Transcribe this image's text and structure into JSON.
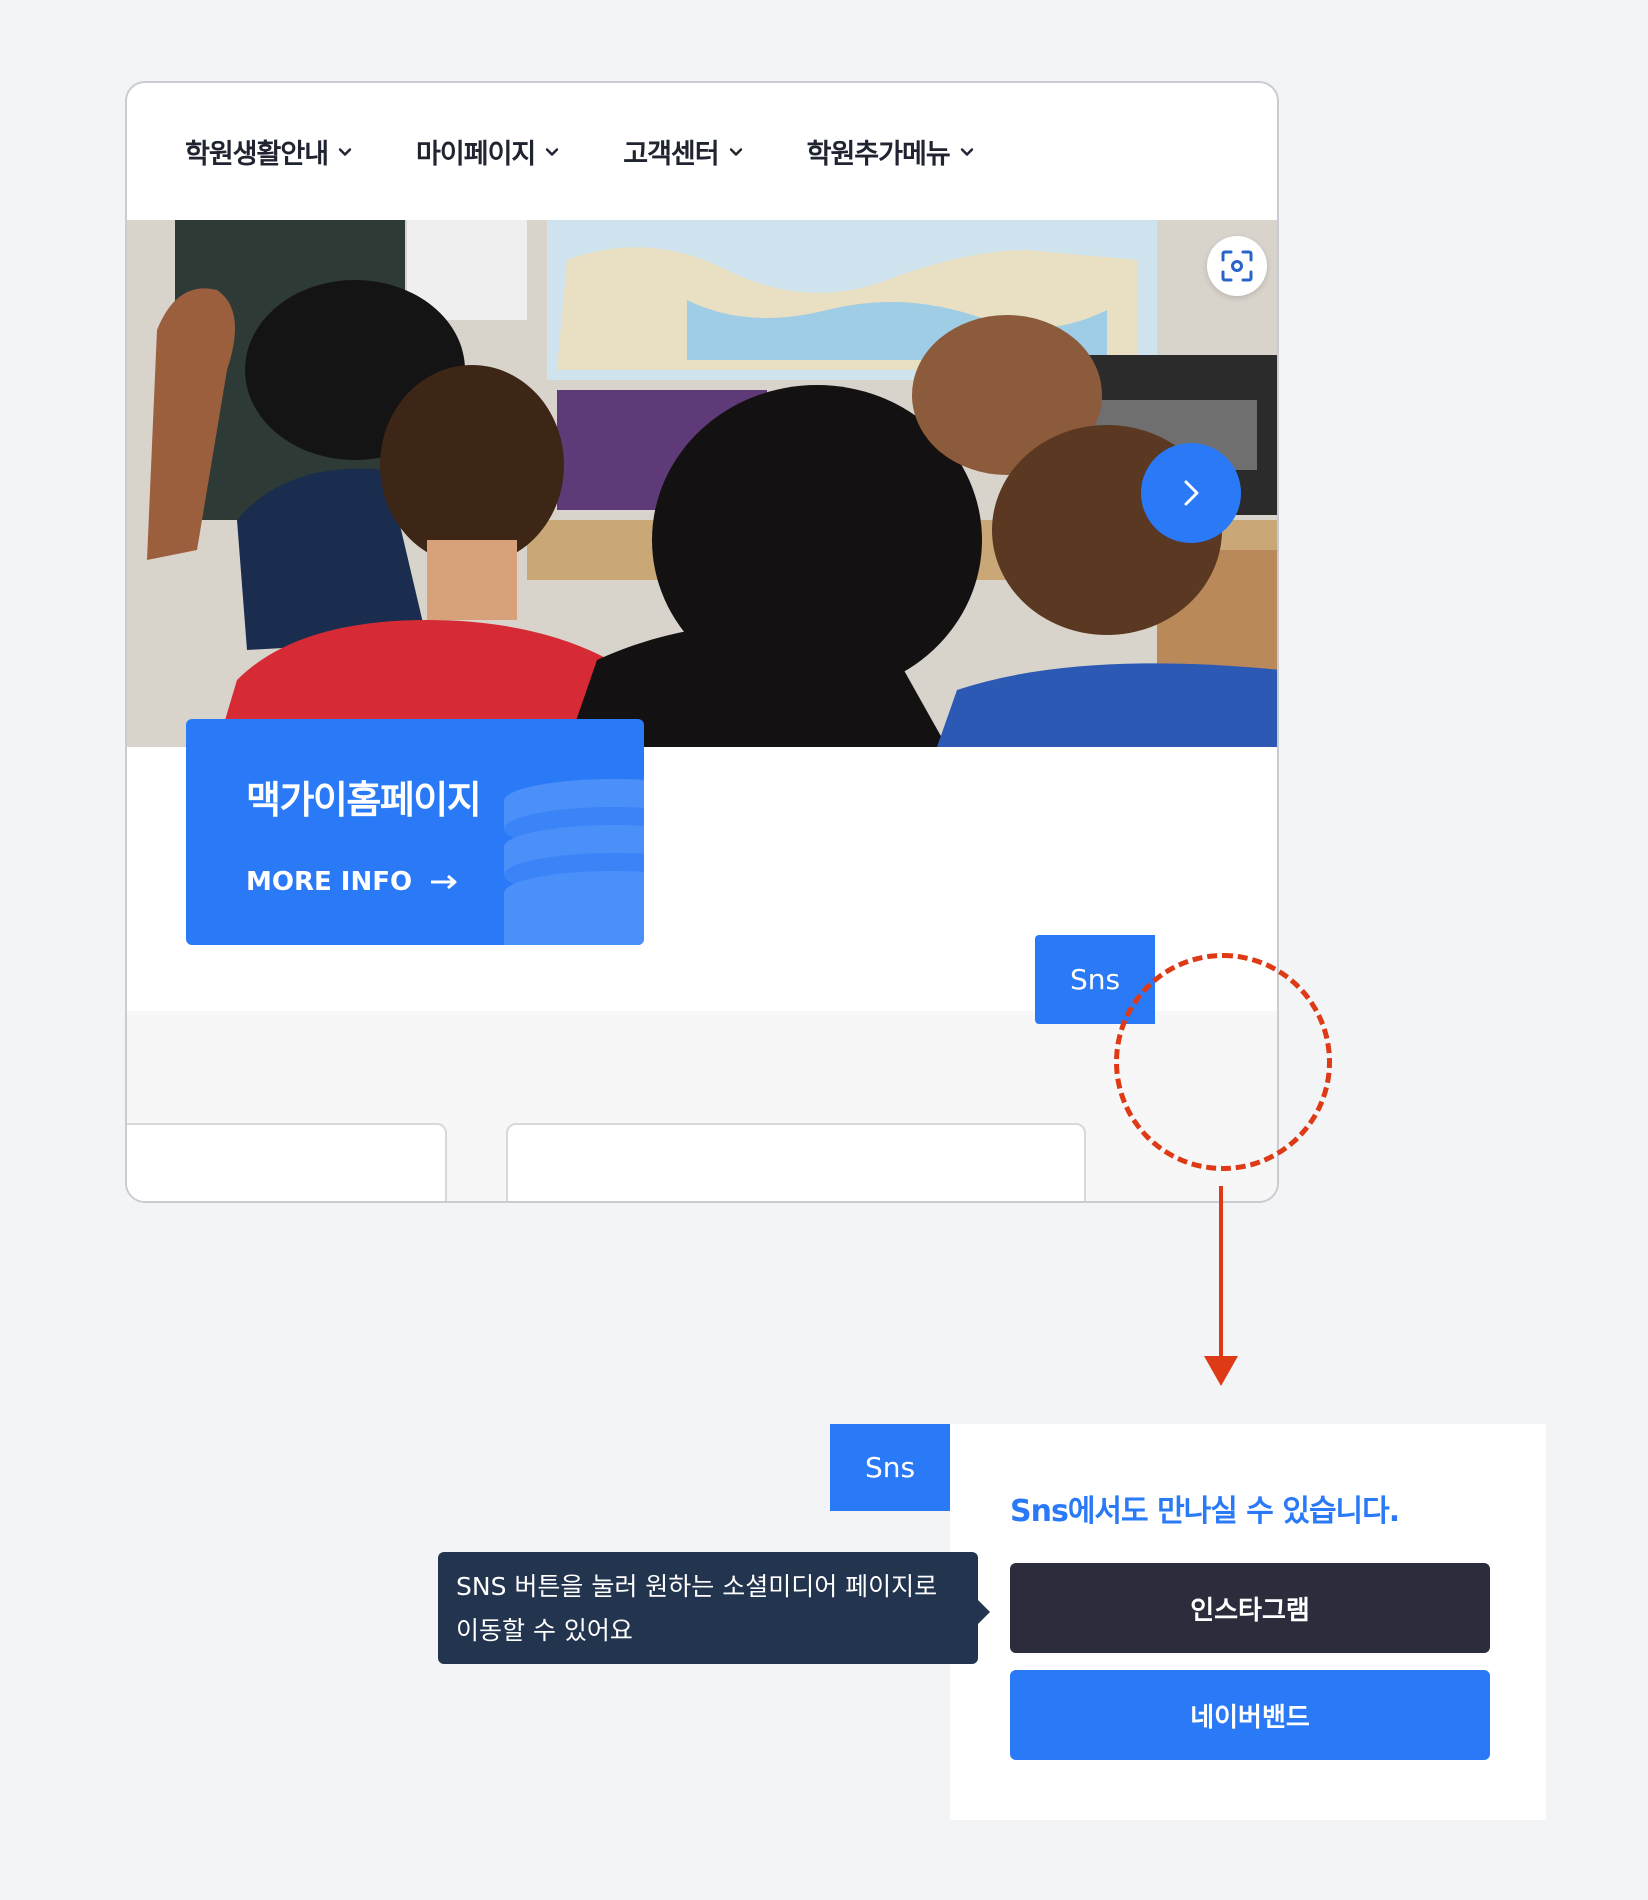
{
  "nav": {
    "items": [
      {
        "label": "학원생활안내"
      },
      {
        "label": "마이페이지"
      },
      {
        "label": "고객센터"
      },
      {
        "label": "학원추가메뉴"
      }
    ]
  },
  "hero": {
    "info_card": {
      "title": "맥가이홈페이지",
      "more_label": "MORE INFO"
    }
  },
  "sns": {
    "tab_label": "Sns",
    "panel": {
      "tab_label": "Sns",
      "heading": "Sns에서도 만나실 수 있습니다.",
      "buttons": [
        {
          "label": "인스타그램"
        },
        {
          "label": "네이버밴드"
        }
      ]
    },
    "tooltip_line1": "SNS 버튼을 눌러 원하는 소셜미디어 페이지로",
    "tooltip_line2": "이동할 수 있어요"
  },
  "colors": {
    "accent": "#2a7af8",
    "dark_button": "#2b2d3c",
    "tooltip_bg": "#23344f",
    "highlight": "#dd3a15",
    "page_bg": "#f3f4f6"
  }
}
